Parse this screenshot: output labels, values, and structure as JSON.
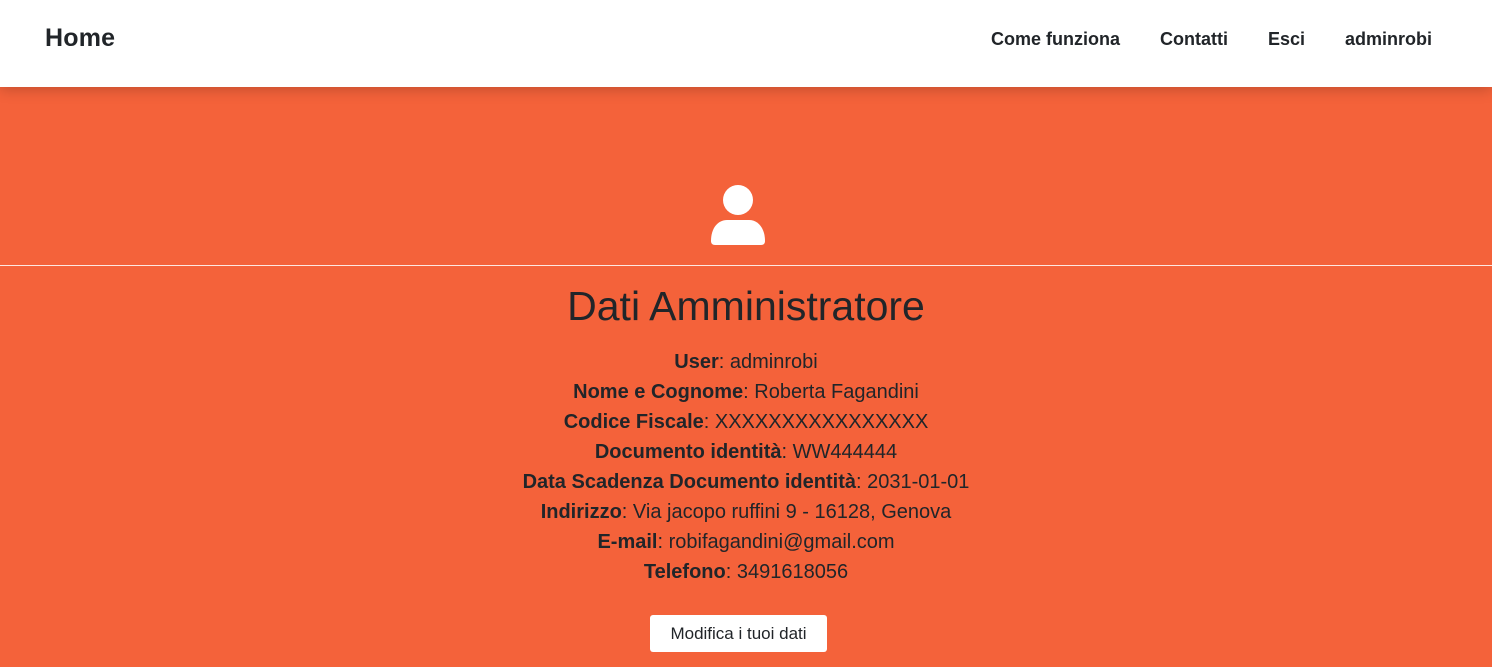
{
  "nav": {
    "brand": "Home",
    "links": [
      "Come funziona",
      "Contatti",
      "Esci",
      "adminrobi"
    ]
  },
  "profile": {
    "icon": "user-icon",
    "title": "Dati Amministratore",
    "fields": [
      {
        "label": "User",
        "value": "adminrobi"
      },
      {
        "label": "Nome e Cognome",
        "value": "Roberta Fagandini"
      },
      {
        "label": "Codice Fiscale",
        "value": "XXXXXXXXXXXXXXXX"
      },
      {
        "label": "Documento identità",
        "value": "WW444444"
      },
      {
        "label": "Data Scadenza Documento identità",
        "value": "2031-01-01"
      },
      {
        "label": "Indirizzo",
        "value": "Via jacopo ruffini 9 - 16128, Genova"
      },
      {
        "label": "E-mail",
        "value": "robifagandini@gmail.com"
      },
      {
        "label": "Telefono",
        "value": "3491618056"
      }
    ],
    "separator": ": ",
    "edit_button": "Modifica i tuoi dati"
  },
  "colors": {
    "accent": "#f4623a",
    "text": "#212529",
    "navbar": "#ffffff"
  }
}
